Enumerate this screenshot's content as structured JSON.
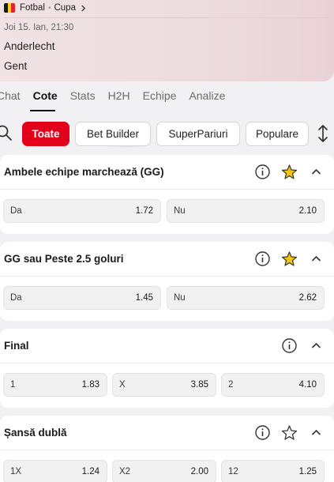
{
  "header": {
    "sport": "Fotbal",
    "competition": "Cupa",
    "datetime": "Joi 15. Ian, 21:30",
    "home_team": "Anderlecht",
    "away_team": "Gent",
    "flag_colors": [
      "#1a1a1a",
      "#f5d21e",
      "#e8202a"
    ]
  },
  "tabs": [
    {
      "label": "Chat",
      "active": false
    },
    {
      "label": "Cote",
      "active": true
    },
    {
      "label": "Stats",
      "active": false
    },
    {
      "label": "H2H",
      "active": false
    },
    {
      "label": "Echipe",
      "active": false
    },
    {
      "label": "Analize",
      "active": false
    }
  ],
  "filters": [
    {
      "label": "Toate",
      "active": true
    },
    {
      "label": "Bet Builder",
      "active": false
    },
    {
      "label": "SuperPariuri",
      "active": false
    },
    {
      "label": "Populare",
      "active": false
    }
  ],
  "markets": [
    {
      "title": "Ambele echipe marchează (GG)",
      "favorite": true,
      "has_favorite_icon": true,
      "odds": [
        {
          "label": "Da",
          "value": "1.72"
        },
        {
          "label": "Nu",
          "value": "2.10"
        }
      ]
    },
    {
      "title": "GG sau Peste 2.5 goluri",
      "favorite": true,
      "has_favorite_icon": true,
      "odds": [
        {
          "label": "Da",
          "value": "1.45"
        },
        {
          "label": "Nu",
          "value": "2.62"
        }
      ]
    },
    {
      "title": "Final",
      "favorite": false,
      "has_favorite_icon": false,
      "odds": [
        {
          "label": "1",
          "value": "1.83"
        },
        {
          "label": "X",
          "value": "3.85"
        },
        {
          "label": "2",
          "value": "4.10"
        }
      ]
    },
    {
      "title": "Șansă dublă",
      "favorite": false,
      "has_favorite_icon": true,
      "odds": [
        {
          "label": "1X",
          "value": "1.24"
        },
        {
          "label": "X2",
          "value": "2.00"
        },
        {
          "label": "12",
          "value": "1.25"
        }
      ]
    }
  ],
  "colors": {
    "accent": "#e3001b",
    "favorite_star": "#f2c40f",
    "hero_bg": "#eddfe1"
  }
}
